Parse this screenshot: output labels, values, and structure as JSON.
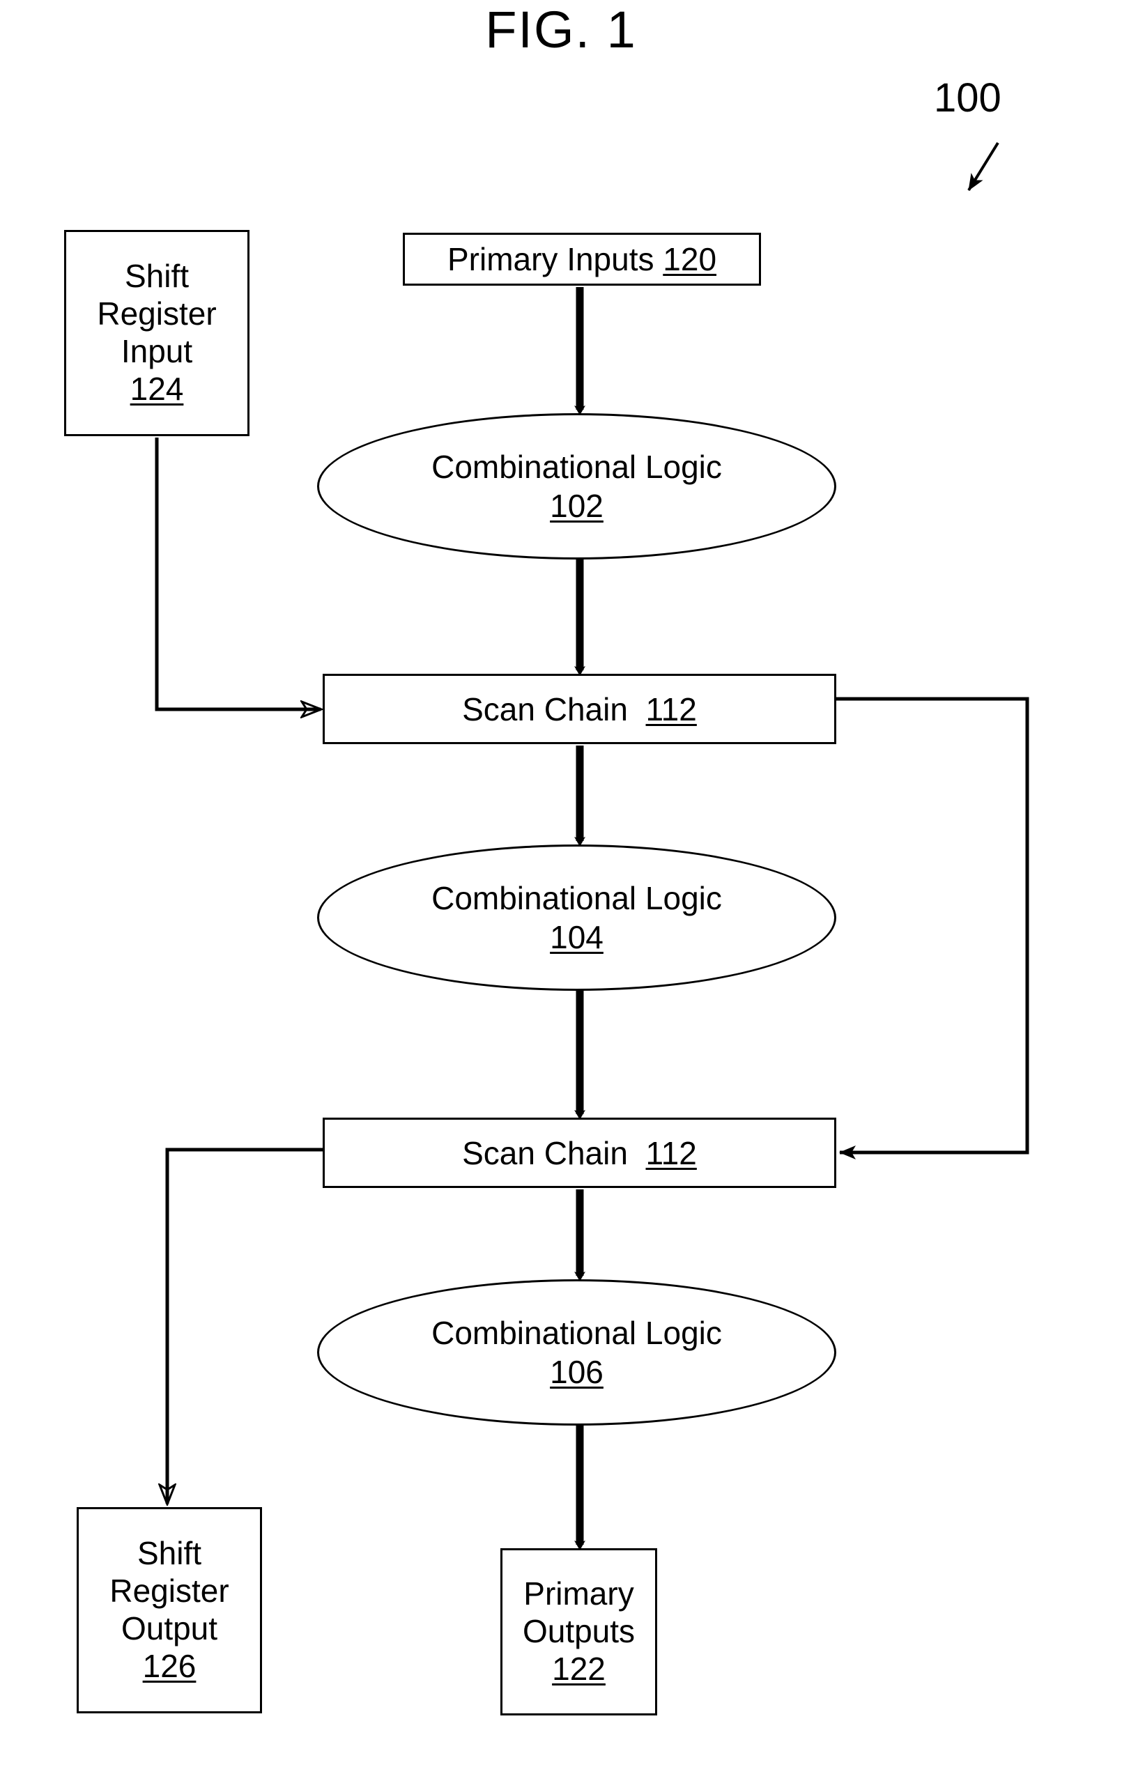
{
  "figure": {
    "title": "FIG. 1",
    "reference_numeral": "100"
  },
  "nodes": {
    "shift_register_input": {
      "line1": "Shift",
      "line2": "Register",
      "line3": "Input",
      "number": "124",
      "shape": "rectangle"
    },
    "primary_inputs": {
      "label": "Primary Inputs",
      "number": "120",
      "shape": "rectangle"
    },
    "combinational_logic_102": {
      "label": "Combinational Logic",
      "number": "102",
      "shape": "ellipse"
    },
    "scan_chain_1": {
      "label": "Scan Chain",
      "number": "112",
      "shape": "rectangle"
    },
    "combinational_logic_104": {
      "label": "Combinational Logic",
      "number": "104",
      "shape": "ellipse"
    },
    "scan_chain_2": {
      "label": "Scan Chain",
      "number": "112",
      "shape": "rectangle"
    },
    "combinational_logic_106": {
      "label": "Combinational Logic",
      "number": "106",
      "shape": "ellipse"
    },
    "shift_register_output": {
      "line1": "Shift",
      "line2": "Register",
      "line3": "Output",
      "number": "126",
      "shape": "rectangle"
    },
    "primary_outputs": {
      "line1": "Primary",
      "line2": "Outputs",
      "number": "122",
      "shape": "rectangle"
    }
  },
  "connections": [
    {
      "from": "primary_inputs",
      "to": "combinational_logic_102",
      "style": "thick-solid-arrow"
    },
    {
      "from": "combinational_logic_102",
      "to": "scan_chain_1",
      "style": "thick-solid-arrow"
    },
    {
      "from": "shift_register_input",
      "to": "scan_chain_1",
      "style": "thin-open-arrow"
    },
    {
      "from": "scan_chain_1",
      "to": "combinational_logic_104",
      "style": "thick-solid-arrow"
    },
    {
      "from": "combinational_logic_104",
      "to": "scan_chain_2",
      "style": "thick-solid-arrow"
    },
    {
      "from": "scan_chain_1",
      "to": "scan_chain_2",
      "style": "thin-solid-arrow-right-feedback"
    },
    {
      "from": "scan_chain_2",
      "to": "combinational_logic_106",
      "style": "thick-solid-arrow"
    },
    {
      "from": "scan_chain_2",
      "to": "shift_register_output",
      "style": "thin-open-arrow"
    },
    {
      "from": "combinational_logic_106",
      "to": "primary_outputs",
      "style": "thick-solid-arrow"
    }
  ],
  "colors": {
    "ink": "#000000",
    "paper": "#ffffff"
  }
}
